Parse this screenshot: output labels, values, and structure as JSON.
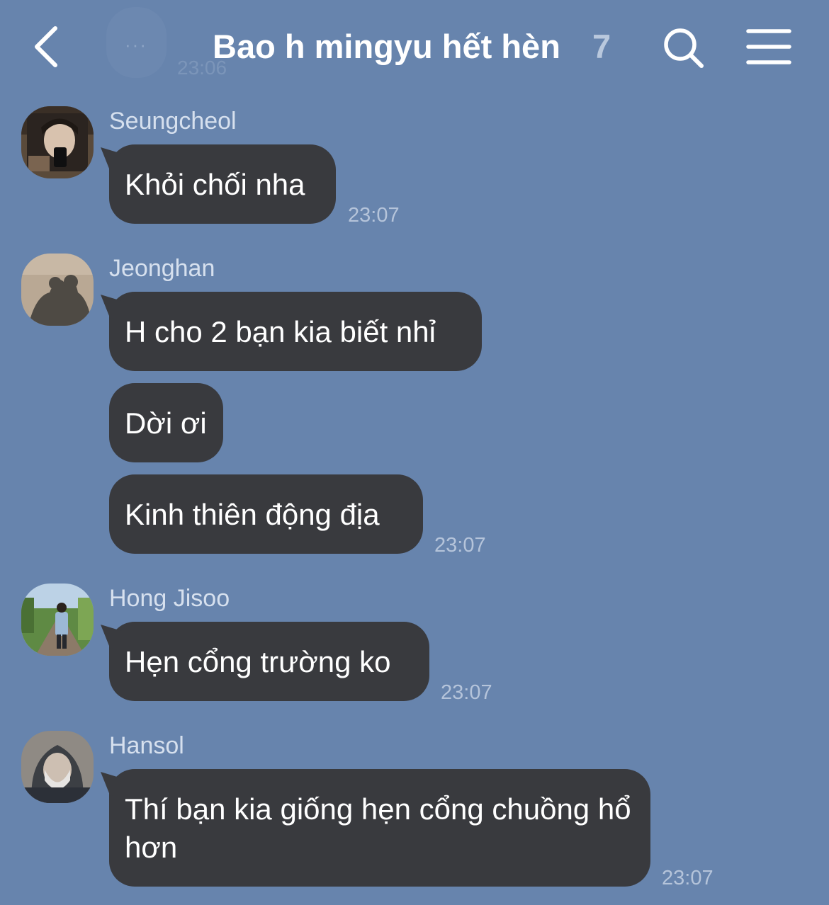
{
  "header": {
    "title": "Bao h mingyu hết hèn",
    "member_count": "7",
    "faded_prev_time": "23:06",
    "faded_prev_dots": "···"
  },
  "messages": {
    "seungcheol": {
      "sender": "Seungcheol",
      "bubbles": [
        "Khỏi chối nha"
      ],
      "time": "23:07"
    },
    "jeonghan": {
      "sender": "Jeonghan",
      "bubbles": [
        "H cho 2 bạn kia biết nhỉ",
        "Dời ơi",
        "Kinh thiên động địa"
      ],
      "time": "23:07"
    },
    "jisoo": {
      "sender": "Hong Jisoo",
      "bubbles": [
        "Hẹn cổng trường ko"
      ],
      "time": "23:07"
    },
    "hansol": {
      "sender": "Hansol",
      "bubbles": [
        "Thí bạn kia giống hẹn cổng chuồng hổ hơn"
      ],
      "time": "23:07"
    }
  },
  "colors": {
    "background": "#6784ad",
    "bubble": "#393a3e",
    "text": "#ffffff"
  }
}
